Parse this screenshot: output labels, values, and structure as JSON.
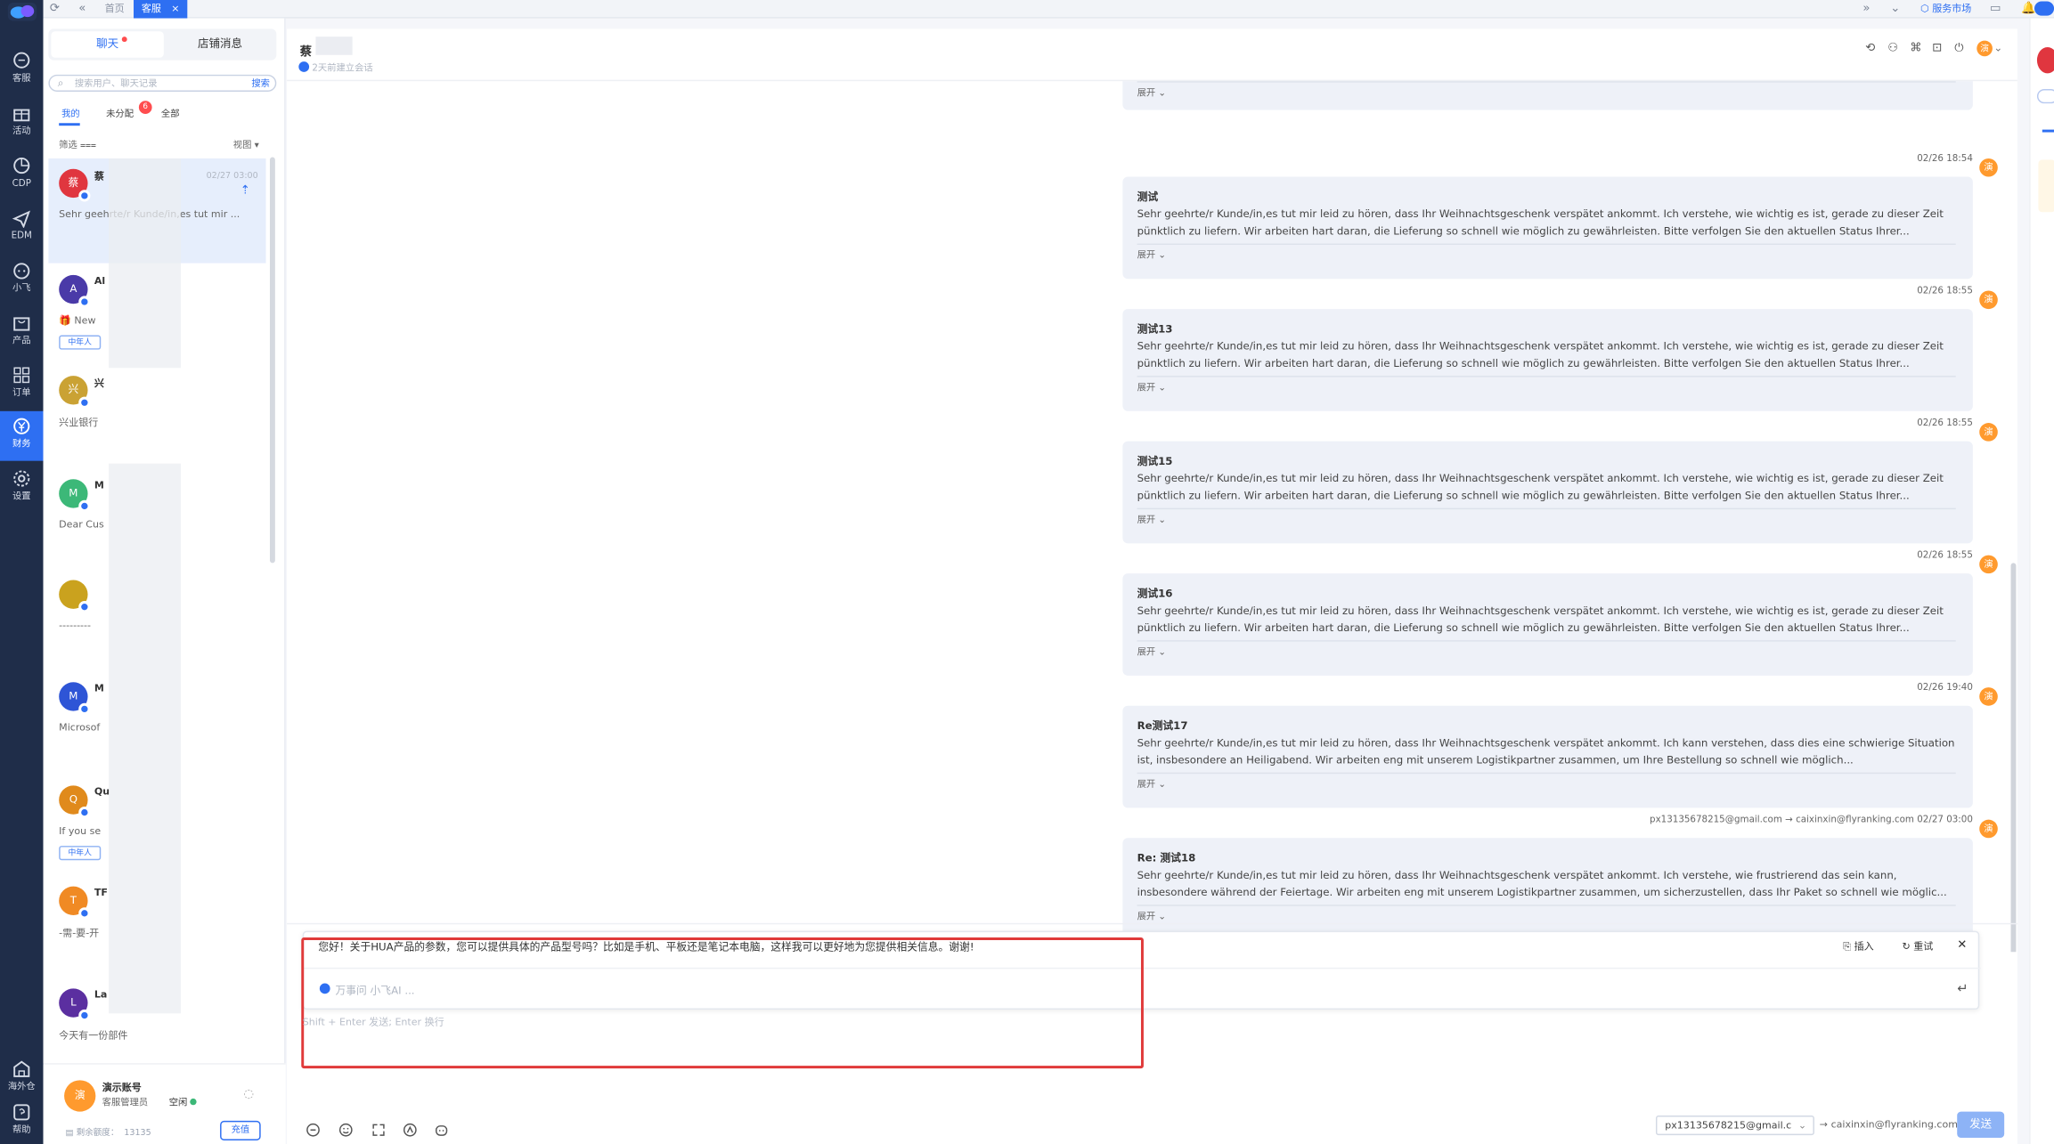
{
  "nav": {
    "items": [
      {
        "label": "客服",
        "icon": "chat-icon"
      },
      {
        "label": "活动",
        "icon": "gift-icon"
      },
      {
        "label": "CDP",
        "icon": "pie-chart-icon"
      },
      {
        "label": "EDM",
        "icon": "send-icon"
      },
      {
        "label": "小飞",
        "icon": "bot-icon"
      },
      {
        "label": "产品",
        "icon": "bag-icon"
      },
      {
        "label": "订单",
        "icon": "grid-icon"
      },
      {
        "label": "财务",
        "icon": "yen-icon"
      },
      {
        "label": "设置",
        "icon": "gear-icon"
      }
    ],
    "bottom": [
      {
        "label": "海外仓",
        "icon": "warehouse-icon"
      },
      {
        "label": "帮助",
        "icon": "help-icon"
      }
    ]
  },
  "topbar": {
    "tabs": [
      {
        "label": "首页"
      },
      {
        "label": "客服"
      }
    ],
    "close_glyph": "×",
    "service_market": "服务市场"
  },
  "sidebar": {
    "tabs": {
      "chat": "聊天",
      "shop": "店铺消息"
    },
    "search": {
      "placeholder": "搜索用户、聊天记录",
      "button": "搜索"
    },
    "filters": {
      "mine": "我的",
      "unassigned": "未分配",
      "unassigned_count": "6",
      "all": "全部"
    },
    "filter_label": "筛选",
    "view_label": "视图",
    "conversations": [
      {
        "avatar": "蔡",
        "avatar_color": "#e0363f",
        "name": "蔡",
        "time": "02/27 03:00",
        "preview": "Sehr geehrte/r Kunde/in,es tut mir ...",
        "tag": ""
      },
      {
        "avatar": "A",
        "avatar_color": "#4a3aa8",
        "name": "Al",
        "time": "",
        "preview": "🎁 New",
        "tag": "中年人"
      },
      {
        "avatar": "兴",
        "avatar_color": "#caa234",
        "name": "兴",
        "time": "",
        "preview": "兴业银行",
        "tag": ""
      },
      {
        "avatar": "M",
        "avatar_color": "#3cb878",
        "name": "M",
        "time": "",
        "preview": "Dear Cus",
        "tag": ""
      },
      {
        "avatar": "",
        "avatar_color": "#caa21e",
        "name": "",
        "time": "",
        "preview": "---------",
        "tag": ""
      },
      {
        "avatar": "M",
        "avatar_color": "#2e55d6",
        "name": "M",
        "time": "",
        "preview": "Microsof",
        "tag": ""
      },
      {
        "avatar": "Q",
        "avatar_color": "#e08a1c",
        "name": "Qu",
        "time": "",
        "preview": "If you se",
        "tag": "中年人"
      },
      {
        "avatar": "T",
        "avatar_color": "#f08a24",
        "name": "TF",
        "time": "",
        "preview": "-需-要-开",
        "tag": ""
      },
      {
        "avatar": "L",
        "avatar_color": "#5b2fa0",
        "name": "La",
        "time": "",
        "preview": "今天有一份部件",
        "tag": ""
      }
    ],
    "account": {
      "avatar": "演",
      "name": "演示账号",
      "role": "客服管理员",
      "status": "空闲",
      "quota_label": "剩余额度：",
      "quota": "13135",
      "recharge": "充值"
    }
  },
  "chat": {
    "header": {
      "name": "蔡",
      "sub": "2天前建立会话"
    },
    "messages": [
      {
        "time": "",
        "title": "",
        "body": "",
        "expand": "展开"
      },
      {
        "time": "02/26 18:54",
        "title": "测试",
        "body": "Sehr geehrte/r Kunde/in,es tut mir leid zu hören, dass Ihr Weihnachtsgeschenk verspätet ankommt. Ich verstehe, wie wichtig es ist, gerade zu dieser Zeit pünktlich zu liefern. Wir arbeiten hart daran, die Lieferung so schnell wie möglich zu gewährleisten. Bitte verfolgen Sie den aktuellen Status Ihrer...",
        "expand": "展开"
      },
      {
        "time": "02/26 18:55",
        "title": "测试13",
        "body": "Sehr geehrte/r Kunde/in,es tut mir leid zu hören, dass Ihr Weihnachtsgeschenk verspätet ankommt. Ich verstehe, wie wichtig es ist, gerade zu dieser Zeit pünktlich zu liefern. Wir arbeiten hart daran, die Lieferung so schnell wie möglich zu gewährleisten. Bitte verfolgen Sie den aktuellen Status Ihrer...",
        "expand": "展开"
      },
      {
        "time": "02/26 18:55",
        "title": "测试15",
        "body": "Sehr geehrte/r Kunde/in,es tut mir leid zu hören, dass Ihr Weihnachtsgeschenk verspätet ankommt. Ich verstehe, wie wichtig es ist, gerade zu dieser Zeit pünktlich zu liefern. Wir arbeiten hart daran, die Lieferung so schnell wie möglich zu gewährleisten. Bitte verfolgen Sie den aktuellen Status Ihrer...",
        "expand": "展开"
      },
      {
        "time": "02/26 18:55",
        "title": "测试16",
        "body": "Sehr geehrte/r Kunde/in,es tut mir leid zu hören, dass Ihr Weihnachtsgeschenk verspätet ankommt. Ich verstehe, wie wichtig es ist, gerade zu dieser Zeit pünktlich zu liefern. Wir arbeiten hart daran, die Lieferung so schnell wie möglich zu gewährleisten. Bitte verfolgen Sie den aktuellen Status Ihrer...",
        "expand": "展开"
      },
      {
        "time": "02/26 19:40",
        "title": "Re测试17",
        "body": "Sehr geehrte/r Kunde/in,es tut mir leid zu hören, dass Ihr Weihnachtsgeschenk verspätet ankommt. Ich kann verstehen, dass dies eine schwierige Situation ist, insbesondere an Heiligabend. Wir arbeiten eng mit unserem Logistikpartner zusammen, um Ihre Bestellung so schnell wie möglich...",
        "expand": "展开"
      },
      {
        "time": "02/27 03:00",
        "sender": "px13135678215@gmail.com",
        "recipient": "caixinxin@flyranking.com",
        "title": "Re:  测试18",
        "body": "Sehr geehrte/r Kunde/in,es tut mir leid zu hören, dass Ihr Weihnachtsgeschenk verspätet ankommt. Ich verstehe, wie frustrierend das sein kann, insbesondere während der Feiertage. Wir arbeiten eng mit unserem Logistikpartner zusammen, um sicherzustellen, dass Ihr Paket so schnell wie möglic...",
        "expand": "展开"
      }
    ],
    "agent_avatar": "演",
    "arrow": "→",
    "composer": {
      "ai_text": "您好！关于HUA产品的参数，您可以提供具体的产品型号吗？比如是手机、平板还是笔记本电脑，这样我可以更好地为您提供相关信息。谢谢!",
      "insert": "插入",
      "retry": "重试",
      "ask_placeholder": "万事问 小飞AI ...",
      "hint": "Shift + Enter 发送; Enter 换行",
      "from": "px13135678215@gmail.c",
      "to": "caixinxin@flyranking.com",
      "send": "发送"
    }
  },
  "colors": {
    "primary": "#2e6ff2",
    "nav_bg": "#1f2d49",
    "card_bg": "#eef1f8",
    "highlight_border": "#e03a3a",
    "agent_avatar": "#ff9a2e"
  }
}
